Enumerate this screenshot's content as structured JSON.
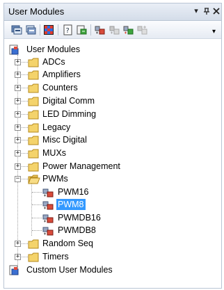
{
  "window": {
    "title": "User Modules",
    "controls": {
      "dropdown": "▾",
      "pin": "ᵽ",
      "close": "✕"
    }
  },
  "toolbar": {
    "buttons": [
      {
        "name": "expand-all-icon"
      },
      {
        "name": "collapse-all-icon"
      },
      {
        "name": "palette-icon"
      },
      {
        "name": "datasheet-icon"
      },
      {
        "name": "place-module-icon"
      },
      {
        "name": "module-config-icon"
      },
      {
        "name": "module-disabled-icon"
      },
      {
        "name": "module-green-icon"
      },
      {
        "name": "module-gray-icon"
      }
    ],
    "overflow": "▾"
  },
  "tree": {
    "root": "User Modules",
    "folders": [
      "ADCs",
      "Amplifiers",
      "Counters",
      "Digital Comm",
      "LED Dimming",
      "Legacy",
      "Misc Digital",
      "MUXs",
      "Power Management",
      "PWMs"
    ],
    "pwm_children": [
      "PWM16",
      "PWM8",
      "PWMDB16",
      "PWMDB8"
    ],
    "selected": "PWM8",
    "after_folders": [
      "Random Seq",
      "Timers"
    ],
    "custom_root": "Custom User Modules"
  },
  "colors": {
    "selection": "#3399ff",
    "folder": "#f4d36b"
  }
}
